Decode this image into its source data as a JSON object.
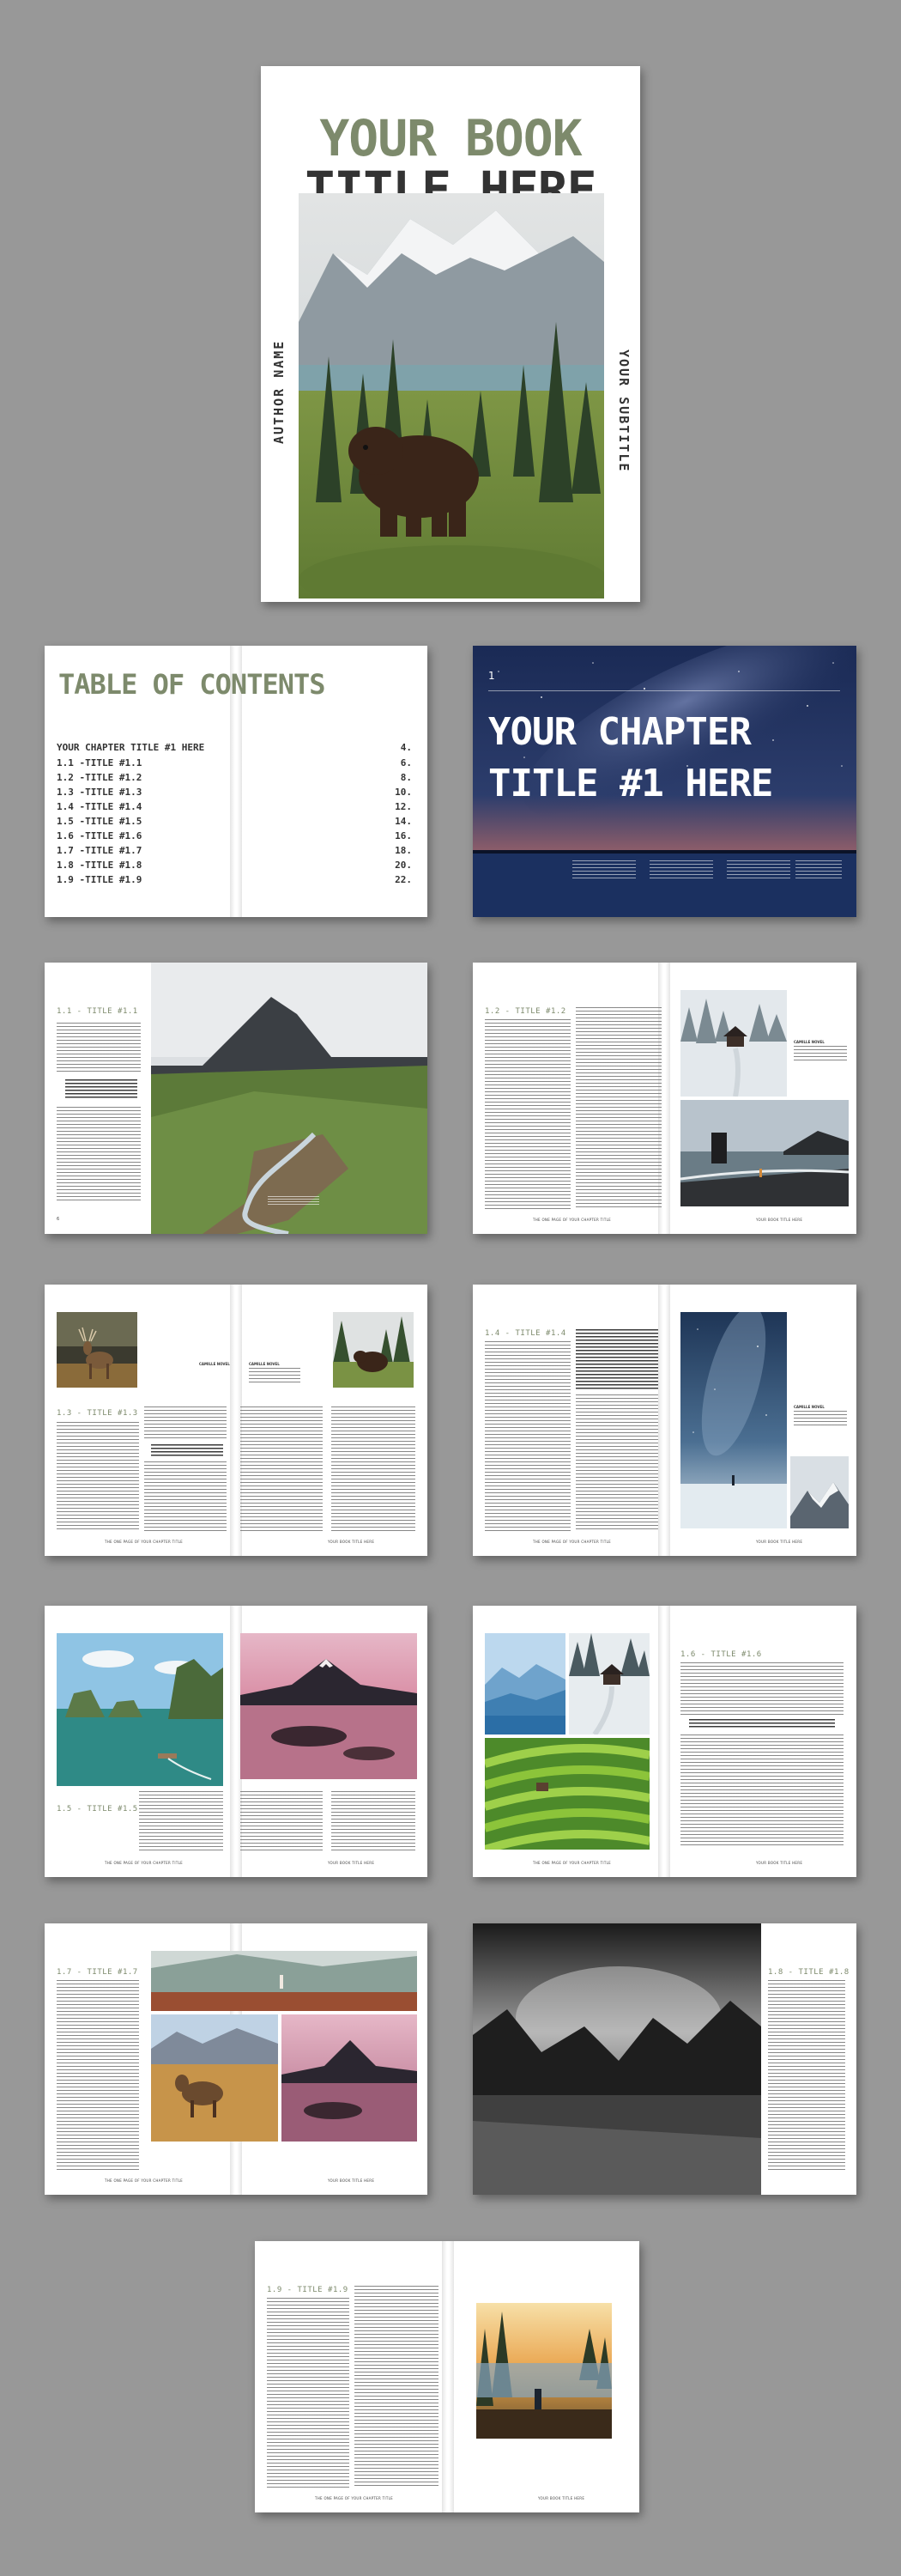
{
  "cover": {
    "title_line1": "YOUR BOOK",
    "title_line2": "TITLE HERE",
    "author": "AUTHOR NAME",
    "subtitle": "YOUR SUBTITLE"
  },
  "toc": {
    "heading": "TABLE OF CONTENTS",
    "entries": [
      {
        "label": "YOUR CHAPTER TITLE #1 HERE",
        "page": "4."
      },
      {
        "label": "1.1 -TITLE #1.1",
        "page": "6."
      },
      {
        "label": "1.2 -TITLE #1.2",
        "page": "8."
      },
      {
        "label": "1.3 -TITLE #1.3",
        "page": "10."
      },
      {
        "label": "1.4 -TITLE #1.4",
        "page": "12."
      },
      {
        "label": "1.5 -TITLE #1.5",
        "page": "14."
      },
      {
        "label": "1.6 -TITLE #1.6",
        "page": "16."
      },
      {
        "label": "1.7 -TITLE #1.7",
        "page": "18."
      },
      {
        "label": "1.8 -TITLE #1.8",
        "page": "20."
      },
      {
        "label": "1.9 -TITLE #1.9",
        "page": "22."
      }
    ]
  },
  "chapter": {
    "number": "1",
    "title_line1": "YOUR CHAPTER",
    "title_line2": "TITLE #1 HERE"
  },
  "sections": {
    "s11": "1.1 - TITLE #1.1",
    "s12": "1.2 - TITLE #1.2",
    "s13": "1.3 - TITLE #1.3",
    "s14": "1.4 - TITLE #1.4",
    "s15": "1.5 - TITLE #1.5",
    "s16": "1.6 - TITLE #1.6",
    "s17": "1.7 - TITLE #1.7",
    "s18": "1.8 - TITLE #1.8",
    "s19": "1.9 - TITLE #1.9"
  },
  "captions": {
    "caption": "CAMILLE NOVEL"
  },
  "footers": {
    "left": "THE ONE PAGE OF YOUR CHAPTER TITLE",
    "right": "YOUR BOOK TITLE HERE"
  },
  "icons": {
    "photos": [
      "bear-photo",
      "mountain-valley-photo",
      "snow-cabin-photo",
      "sea-stack-photo",
      "deer-photo",
      "bear-forest-photo",
      "milky-way-photo",
      "snow-mountain-photo",
      "bay-islands-photo",
      "pink-lake-photo",
      "blue-mountain-photo",
      "snow-cabin-photo-2",
      "rice-terrace-photo",
      "desert-photo",
      "horse-photo",
      "pink-mountain-photo",
      "bw-mountains-photo",
      "lake-hiker-photo"
    ]
  },
  "colors": {
    "background": "#989898",
    "accent_green": "#7d8a6c",
    "dark_text": "#333333"
  }
}
